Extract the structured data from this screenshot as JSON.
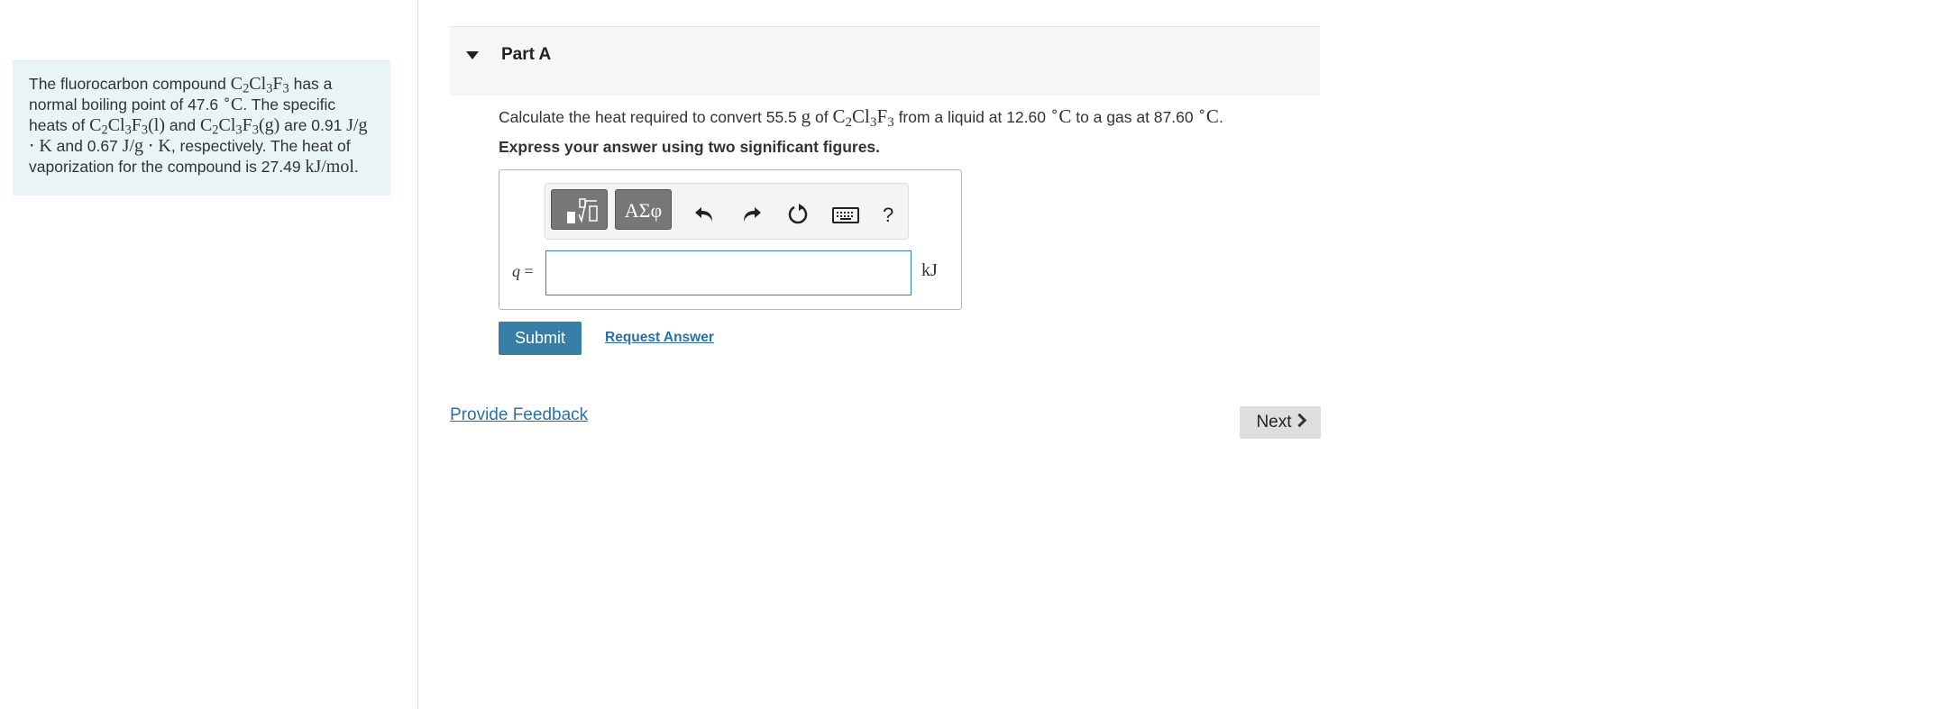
{
  "intro": {
    "t1": "The fluorocarbon compound ",
    "comp1": {
      "a": "C",
      "a_sub": "2",
      "b": "Cl",
      "b_sub": "3",
      "c": "F",
      "c_sub": "3"
    },
    "t2": " has a normal boiling point of 47.6 ",
    "deg1": {
      "sup": "∘",
      "unit": "C"
    },
    "t3": ". The specific heats of ",
    "comp2": {
      "a": "C",
      "a_sub": "2",
      "b": "Cl",
      "b_sub": "3",
      "c": "F",
      "c_sub": "3",
      "phase": "(l)"
    },
    "t4": " and ",
    "comp3": {
      "a": "C",
      "a_sub": "2",
      "b": "Cl",
      "b_sub": "3",
      "c": "F",
      "c_sub": "3",
      "phase": "(g)"
    },
    "t5": " are 0.91 ",
    "unit1": "J/g ⋅ K",
    "t6": " and 0.67 ",
    "unit2": "J/g ⋅ K",
    "t7": ", respectively. The heat of vaporization for the compound is 27.49 ",
    "unit3": "kJ/mol",
    "t8": "."
  },
  "part": {
    "title": "Part A"
  },
  "question": {
    "t1": "Calculate the heat required to convert 55.5 ",
    "g": "g",
    "t2": " of ",
    "comp": {
      "a": "C",
      "a_sub": "2",
      "b": "Cl",
      "b_sub": "3",
      "c": "F",
      "c_sub": "3"
    },
    "t3": " from a liquid at 12.60 ",
    "deg1": {
      "sup": "∘",
      "unit": "C"
    },
    "t4": " to a gas at 87.60 ",
    "deg2": {
      "sup": "∘",
      "unit": "C"
    },
    "t5": "."
  },
  "instruction": "Express your answer using two significant figures.",
  "toolbar": {
    "symbols_label": "ΑΣφ",
    "help_label": "?"
  },
  "answer": {
    "var": "q",
    "equals": " =",
    "value": "",
    "unit": "kJ"
  },
  "actions": {
    "submit_label": "Submit",
    "request_answer_label": "Request Answer",
    "feedback_label": "Provide Feedback",
    "next_label": "Next"
  },
  "colors": {
    "primary": "#377ea4",
    "link": "#2a6fa8",
    "intro_bg": "#e8f4f6"
  },
  "icons": [
    "caret-down-icon",
    "templates-icon",
    "undo-icon",
    "redo-icon",
    "reset-icon",
    "keyboard-icon",
    "help-icon",
    "chevron-right-icon"
  ]
}
